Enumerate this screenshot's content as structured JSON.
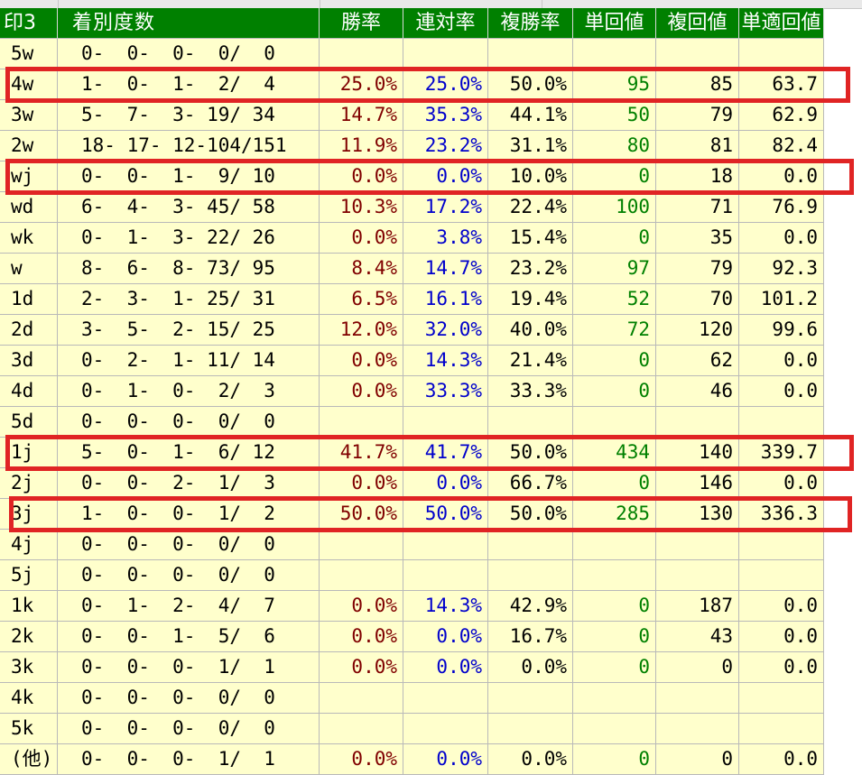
{
  "headers": {
    "mark": "印3",
    "counts": "着別度数",
    "win_rate": "勝率",
    "quinella_rate": "連対率",
    "place_rate": "複勝率",
    "win_return": "単回値",
    "place_return": "複回値",
    "adj_win_return": "単適回値"
  },
  "rows": [
    {
      "mark": "5w",
      "counts": "0-  0-  0-  0/  0",
      "win": "",
      "quin": "",
      "plc": "",
      "tan": "",
      "fuku": "",
      "adj": ""
    },
    {
      "mark": "4w",
      "counts": "1-  0-  1-  2/  4",
      "win": "25.0%",
      "quin": "25.0%",
      "plc": "50.0%",
      "tan": "95",
      "fuku": "85",
      "adj": "63.7"
    },
    {
      "mark": "3w",
      "counts": "5-  7-  3- 19/ 34",
      "win": "14.7%",
      "quin": "35.3%",
      "plc": "44.1%",
      "tan": "50",
      "fuku": "79",
      "adj": "62.9"
    },
    {
      "mark": "2w",
      "counts": "18- 17- 12-104/151",
      "win": "11.9%",
      "quin": "23.2%",
      "plc": "31.1%",
      "tan": "80",
      "fuku": "81",
      "adj": "82.4"
    },
    {
      "mark": "wj",
      "counts": "0-  0-  1-  9/ 10",
      "win": "0.0%",
      "quin": "0.0%",
      "plc": "10.0%",
      "tan": "0",
      "fuku": "18",
      "adj": "0.0"
    },
    {
      "mark": "wd",
      "counts": "6-  4-  3- 45/ 58",
      "win": "10.3%",
      "quin": "17.2%",
      "plc": "22.4%",
      "tan": "100",
      "fuku": "71",
      "adj": "76.9"
    },
    {
      "mark": "wk",
      "counts": "0-  1-  3- 22/ 26",
      "win": "0.0%",
      "quin": "3.8%",
      "plc": "15.4%",
      "tan": "0",
      "fuku": "35",
      "adj": "0.0"
    },
    {
      "mark": "w",
      "counts": "8-  6-  8- 73/ 95",
      "win": "8.4%",
      "quin": "14.7%",
      "plc": "23.2%",
      "tan": "97",
      "fuku": "79",
      "adj": "92.3"
    },
    {
      "mark": "1d",
      "counts": "2-  3-  1- 25/ 31",
      "win": "6.5%",
      "quin": "16.1%",
      "plc": "19.4%",
      "tan": "52",
      "fuku": "70",
      "adj": "101.2"
    },
    {
      "mark": "2d",
      "counts": "3-  5-  2- 15/ 25",
      "win": "12.0%",
      "quin": "32.0%",
      "plc": "40.0%",
      "tan": "72",
      "fuku": "120",
      "adj": "99.6"
    },
    {
      "mark": "3d",
      "counts": "0-  2-  1- 11/ 14",
      "win": "0.0%",
      "quin": "14.3%",
      "plc": "21.4%",
      "tan": "0",
      "fuku": "62",
      "adj": "0.0"
    },
    {
      "mark": "4d",
      "counts": "0-  1-  0-  2/  3",
      "win": "0.0%",
      "quin": "33.3%",
      "plc": "33.3%",
      "tan": "0",
      "fuku": "46",
      "adj": "0.0"
    },
    {
      "mark": "5d",
      "counts": "0-  0-  0-  0/  0",
      "win": "",
      "quin": "",
      "plc": "",
      "tan": "",
      "fuku": "",
      "adj": ""
    },
    {
      "mark": "1j",
      "counts": "5-  0-  1-  6/ 12",
      "win": "41.7%",
      "quin": "41.7%",
      "plc": "50.0%",
      "tan": "434",
      "fuku": "140",
      "adj": "339.7"
    },
    {
      "mark": "2j",
      "counts": "0-  0-  2-  1/  3",
      "win": "0.0%",
      "quin": "0.0%",
      "plc": "66.7%",
      "tan": "0",
      "fuku": "146",
      "adj": "0.0"
    },
    {
      "mark": "3j",
      "counts": "1-  0-  0-  1/  2",
      "win": "50.0%",
      "quin": "50.0%",
      "plc": "50.0%",
      "tan": "285",
      "fuku": "130",
      "adj": "336.3"
    },
    {
      "mark": "4j",
      "counts": "0-  0-  0-  0/  0",
      "win": "",
      "quin": "",
      "plc": "",
      "tan": "",
      "fuku": "",
      "adj": ""
    },
    {
      "mark": "5j",
      "counts": "0-  0-  0-  0/  0",
      "win": "",
      "quin": "",
      "plc": "",
      "tan": "",
      "fuku": "",
      "adj": ""
    },
    {
      "mark": "1k",
      "counts": "0-  1-  2-  4/  7",
      "win": "0.0%",
      "quin": "14.3%",
      "plc": "42.9%",
      "tan": "0",
      "fuku": "187",
      "adj": "0.0"
    },
    {
      "mark": "2k",
      "counts": "0-  0-  1-  5/  6",
      "win": "0.0%",
      "quin": "0.0%",
      "plc": "16.7%",
      "tan": "0",
      "fuku": "43",
      "adj": "0.0"
    },
    {
      "mark": "3k",
      "counts": "0-  0-  0-  1/  1",
      "win": "0.0%",
      "quin": "0.0%",
      "plc": "0.0%",
      "tan": "0",
      "fuku": "0",
      "adj": "0.0"
    },
    {
      "mark": "4k",
      "counts": "0-  0-  0-  0/  0",
      "win": "",
      "quin": "",
      "plc": "",
      "tan": "",
      "fuku": "",
      "adj": ""
    },
    {
      "mark": "5k",
      "counts": "0-  0-  0-  0/  0",
      "win": "",
      "quin": "",
      "plc": "",
      "tan": "",
      "fuku": "",
      "adj": ""
    },
    {
      "mark": "(他)",
      "counts": "0-  0-  0-  1/  1",
      "win": "0.0%",
      "quin": "0.0%",
      "plc": "0.0%",
      "tan": "0",
      "fuku": "0",
      "adj": "0.0"
    }
  ],
  "highlighted_rows": [
    "4w",
    "wj",
    "1j",
    "3j"
  ],
  "colors": {
    "header_bg": "#008000",
    "cell_bg": "#ffffcc",
    "win_rate": "#800000",
    "quinella_rate": "#0000cc",
    "win_return": "#008000",
    "highlight": "#e02424"
  }
}
